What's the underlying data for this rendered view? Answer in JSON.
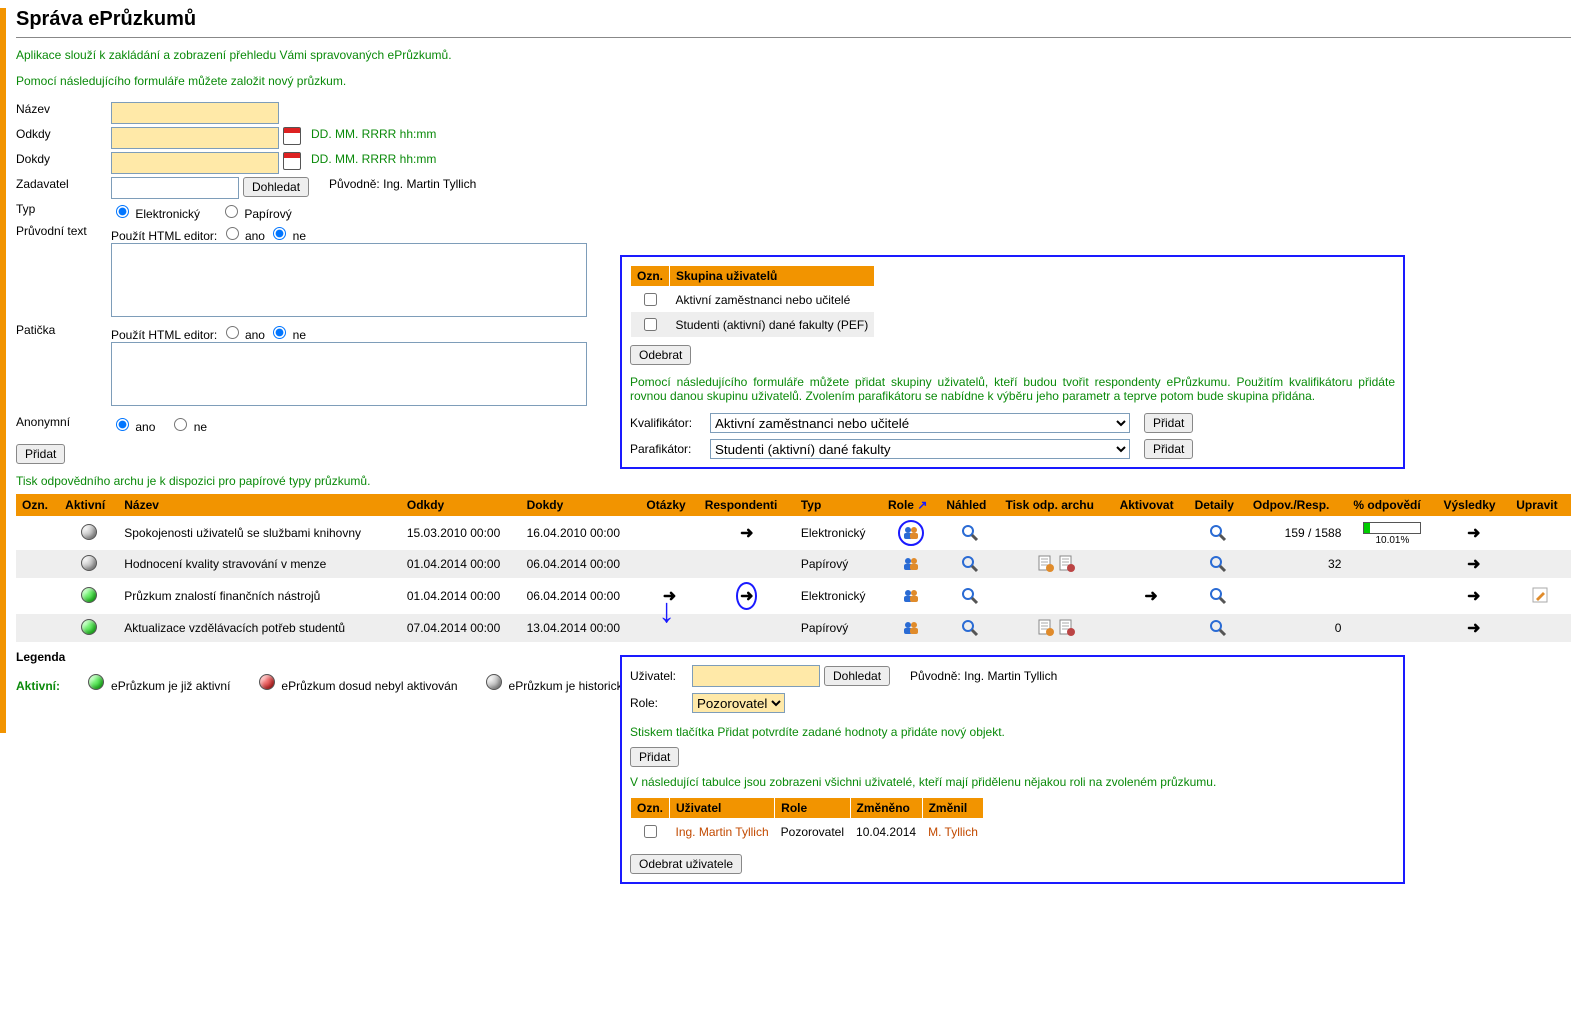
{
  "title": "Správa ePrůzkumů",
  "intro1": "Aplikace slouží k zakládání a zobrazení přehledu Vámi spravovaných ePrůzkumů.",
  "intro2": "Pomocí následujícího formuláře můžete založit nový průzkum.",
  "form": {
    "name_label": "Název",
    "from_label": "Odkdy",
    "to_label": "Dokdy",
    "date_hint": "DD. MM. RRRR hh:mm",
    "submitter_label": "Zadavatel",
    "search_btn": "Dohledat",
    "origin_prefix": "Původně:",
    "origin_name": "Ing. Martin Tyllich",
    "type_label": "Typ",
    "type_electronic": "Elektronický",
    "type_paper": "Papírový",
    "cover_label": "Průvodní text",
    "footer_label": "Patička",
    "html_editor_label": "Použít HTML editor:",
    "opt_yes": "ano",
    "opt_no": "ne",
    "anon_label": "Anonymní",
    "add_btn": "Přidat"
  },
  "note_paper": "Tisk odpovědního archu je k dispozici pro papírové typy průzkumů.",
  "groups_popup": {
    "col_mark": "Ozn.",
    "col_group": "Skupina uživatelů",
    "row1": "Aktivní zaměstnanci nebo učitelé",
    "row2": "Studenti (aktivní) dané fakulty (PEF)",
    "remove_btn": "Odebrat",
    "help": "Pomocí následujícího formuláře můžete přidat skupiny uživatelů, kteří budou tvořit respondenty ePrůzkumu. Použitím kvalifikátoru přidáte rovnou danou skupinu uživatelů. Zvolením parafikátoru se nabídne k výběru jeho parametr a teprve potom bude skupina přidána.",
    "qualifier_label": "Kvalifikátor:",
    "qualifier_value": "Aktivní zaměstnanci nebo učitelé",
    "paraf_label": "Parafikátor:",
    "paraf_value": "Studenti (aktivní) dané fakulty",
    "add_btn": "Přidat"
  },
  "main_table": {
    "headers": [
      "Ozn.",
      "Aktivní",
      "Název",
      "Odkdy",
      "Dokdy",
      "Otázky",
      "Respondenti",
      "Typ",
      "Role",
      "Náhled",
      "Tisk odp. archu",
      "Aktivovat",
      "Detaily",
      "Odpov./Resp.",
      "% odpovědí",
      "Výsledky",
      "Upravit"
    ],
    "rows": [
      {
        "active": "grey",
        "name": "Spokojenosti uživatelů se službami knihovny",
        "from": "15.03.2010 00:00",
        "to": "16.04.2010 00:00",
        "resp_arrow": true,
        "type": "Elektronický",
        "pct": "10.01%",
        "pct_bar": 10,
        "answers": "159 / 1588",
        "results_arrow": true
      },
      {
        "active": "grey",
        "name": "Hodnocení kvality stravování v menze",
        "from": "01.04.2014 00:00",
        "to": "06.04.2014 00:00",
        "type": "Papírový",
        "answers": "32",
        "print_icons": true,
        "results_arrow": true
      },
      {
        "active": "green",
        "name": "Průzkum znalostí finančních nástrojů",
        "from": "01.04.2014 00:00",
        "to": "06.04.2014 00:00",
        "q_arrow": true,
        "resp_arrow_circled": true,
        "type": "Elektronický",
        "activate_arrow": true,
        "answers": "",
        "results_arrow": true,
        "edit_icon": true
      },
      {
        "active": "green",
        "name": "Aktualizace vzdělávacích potřeb studentů",
        "from": "07.04.2014 00:00",
        "to": "13.04.2014 00:00",
        "type": "Papírový",
        "answers": "0",
        "print_icons": true,
        "results_arrow": true
      }
    ]
  },
  "legend": {
    "title": "Legenda",
    "active_label": "Aktivní:",
    "green_text": "ePrůzkum je již aktivní",
    "red_text": "ePrůzkum dosud nebyl aktivován",
    "grey_text": "ePrůzkum je historický"
  },
  "roles_popup": {
    "user_label": "Uživatel:",
    "search_btn": "Dohledat",
    "origin_prefix": "Původně:",
    "origin_name": "Ing. Martin Tyllich",
    "role_label": "Role:",
    "role_value": "Pozorovatel",
    "confirm_text": "Stiskem tlačítka Přidat potvrdíte zadané hodnoty a přidáte nový objekt.",
    "add_btn": "Přidat",
    "list_text": "V následující tabulce jsou zobrazeni všichni uživatelé, kteří mají přidělenu nějakou roli na zvoleném průzkumu.",
    "th_mark": "Ozn.",
    "th_user": "Uživatel",
    "th_role": "Role",
    "th_changed": "Změněno",
    "th_changed_by": "Změnil",
    "r_user": "Ing. Martin Tyllich",
    "r_role": "Pozorovatel",
    "r_changed": "10.04.2014",
    "r_by": "M. Tyllich",
    "remove_btn": "Odebrat uživatele"
  }
}
